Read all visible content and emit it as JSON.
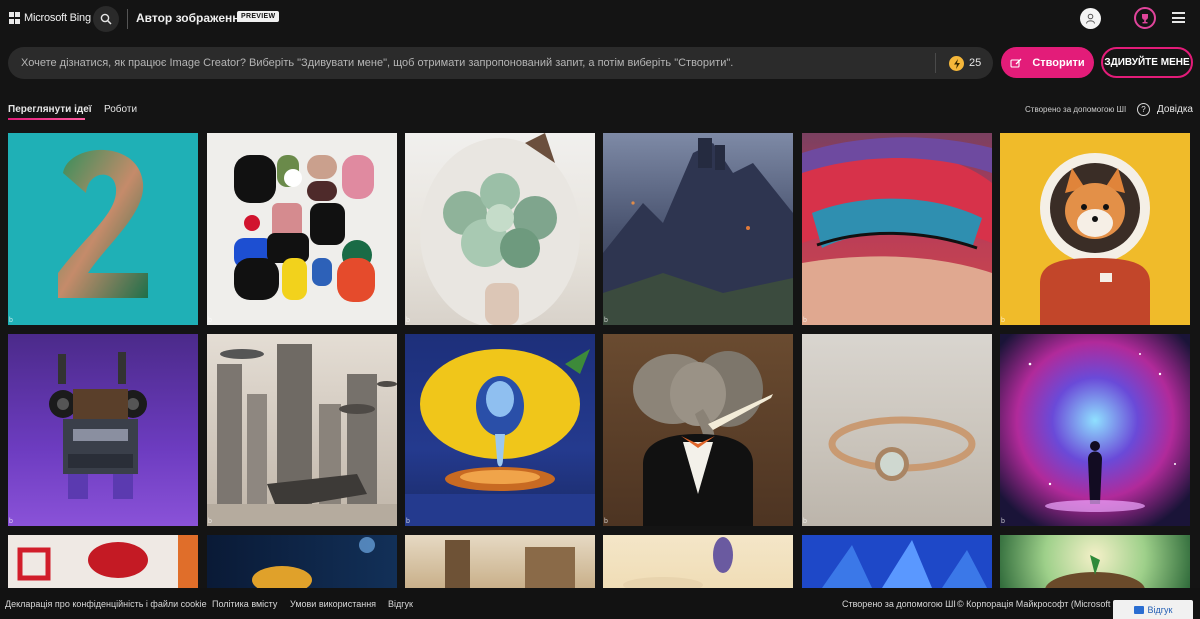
{
  "header": {
    "brand": "Microsoft Bing",
    "title": "Автор зображення",
    "badge": "PREVIEW",
    "icons": [
      "microsoft-logo-icon",
      "search-icon",
      "user-icon",
      "rewards-trophy-icon",
      "hamburger-menu-icon"
    ]
  },
  "prompt": {
    "placeholder": "Хочете дізнатися, як працює Image Creator? Виберіть \"Здивувати мене\", щоб отримати запропонований запит, а потім виберіть \"Створити\".",
    "value": "",
    "boosts": "25",
    "create_label": "Створити",
    "surprise_label": "ЗДИВУЙТЕ МЕНЕ"
  },
  "tabs": [
    {
      "label": "Переглянути ідеї",
      "active": true
    },
    {
      "label": "Роботи",
      "active": false
    }
  ],
  "ai_note": "Створено за допомогою ШІ",
  "help_label": "Довідка",
  "gallery": {
    "watermark": "b",
    "tiles": [
      {
        "name": "number-two-leaves"
      },
      {
        "name": "abstract-shapes"
      },
      {
        "name": "succulent-bouquet"
      },
      {
        "name": "dark-castle"
      },
      {
        "name": "glitter-eye-makeup"
      },
      {
        "name": "shiba-astronaut"
      },
      {
        "name": "purple-robot"
      },
      {
        "name": "futuristic-city"
      },
      {
        "name": "surreal-lemon"
      },
      {
        "name": "elephant-in-suit"
      },
      {
        "name": "gold-ring"
      },
      {
        "name": "nebula-figure"
      },
      {
        "name": "red-hat"
      },
      {
        "name": "glowing-fish"
      },
      {
        "name": "ruins-painting"
      },
      {
        "name": "lavender-vase"
      },
      {
        "name": "blue-flower"
      },
      {
        "name": "tiny-planet-tree"
      }
    ]
  },
  "footer": {
    "privacy": "Декларація про конфіденційність і файли cookie",
    "content_policy": "Політика вмісту",
    "terms": "Умови використання",
    "feedback_link": "Відгук",
    "ai_note": "Створено за допомогою ШІ",
    "copyright": "© Корпорація Майкрософт (Microsoft C",
    "feedback_button": "Відгук"
  },
  "colors": {
    "accent": "#e31c79",
    "background": "#141414",
    "coin": "#f5b73a"
  }
}
